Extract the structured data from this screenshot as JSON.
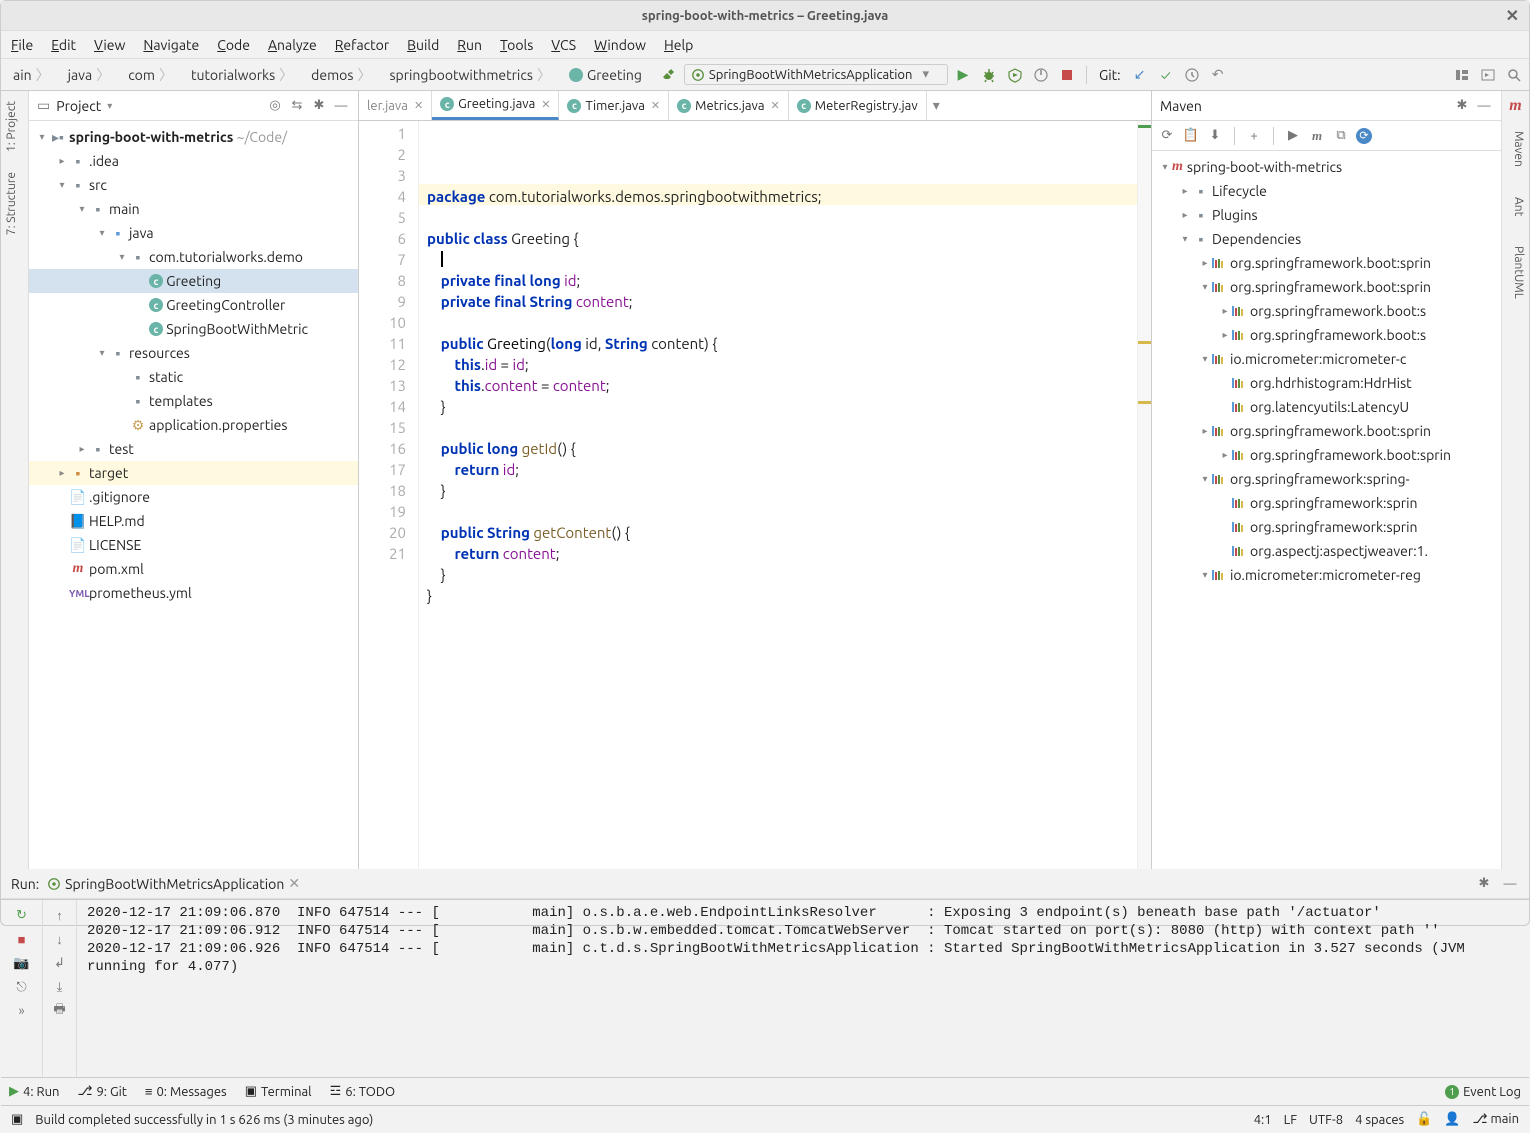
{
  "window": {
    "title": "spring-boot-with-metrics – Greeting.java"
  },
  "menu": [
    "File",
    "Edit",
    "View",
    "Navigate",
    "Code",
    "Analyze",
    "Refactor",
    "Build",
    "Run",
    "Tools",
    "VCS",
    "Window",
    "Help"
  ],
  "breadcrumbs": [
    "ain",
    "java",
    "com",
    "tutorialworks",
    "demos",
    "springbootwithmetrics",
    "Greeting"
  ],
  "runConfig": "SpringBootWithMetricsApplication",
  "git_label": "Git:",
  "leftGutter": [
    "1: Project",
    "7: Structure"
  ],
  "rightGutter": [
    "Maven",
    "Ant",
    "PlantUML"
  ],
  "projectPanel": {
    "title": "Project"
  },
  "projectTree": {
    "root": {
      "name": "spring-boot-with-metrics",
      "path": "~/Code/"
    },
    "items": [
      ".idea",
      "src",
      "main",
      "java",
      "com.tutorialworks.demo",
      "Greeting",
      "GreetingController",
      "SpringBootWithMetric",
      "resources",
      "static",
      "templates",
      "application.properties",
      "test",
      "target",
      ".gitignore",
      "HELP.md",
      "LICENSE",
      "pom.xml",
      "prometheus.yml"
    ]
  },
  "tabs": [
    {
      "label": "ler.java",
      "active": false,
      "partial": true
    },
    {
      "label": "Greeting.java",
      "active": true
    },
    {
      "label": "Timer.java",
      "active": false
    },
    {
      "label": "Metrics.java",
      "active": false
    },
    {
      "label": "MeterRegistry.jav",
      "active": false,
      "partial": true
    }
  ],
  "lineCount": 21,
  "codeLines": [
    "package com.tutorialworks.demos.springbootwithmetrics;",
    "",
    "public class Greeting {",
    "    ",
    "    private final long id;",
    "    private final String content;",
    "",
    "    public Greeting(long id, String content) {",
    "        this.id = id;",
    "        this.content = content;",
    "    }",
    "",
    "    public long getId() {",
    "        return id;",
    "    }",
    "",
    "    public String getContent() {",
    "        return content;",
    "    }",
    "}",
    ""
  ],
  "mavenPanel": {
    "title": "Maven"
  },
  "mavenTree": {
    "rootProject": "spring-boot-with-metrics",
    "folders": [
      "Lifecycle",
      "Plugins",
      "Dependencies"
    ],
    "deps": [
      "org.springframework.boot:sprin",
      "org.springframework.boot:sprin",
      "org.springframework.boot:s",
      "org.springframework.boot:s",
      "io.micrometer:micrometer-c",
      "org.hdrhistogram:HdrHist",
      "org.latencyutils:LatencyU",
      "org.springframework.boot:sprin",
      "org.springframework.boot:sprin",
      "org.springframework:spring-",
      "org.springframework:sprin",
      "org.springframework:sprin",
      "org.aspectj:aspectjweaver:1.",
      "io.micrometer:micrometer-reg"
    ]
  },
  "runPanel": {
    "label": "Run:",
    "tabName": "SpringBootWithMetricsApplication",
    "consoleText": "2020-12-17 21:09:06.870  INFO 647514 --- [           main] o.s.b.a.e.web.EndpointLinksResolver      : Exposing 3 endpoint(s) beneath base path '/actuator'\n2020-12-17 21:09:06.912  INFO 647514 --- [           main] o.s.b.w.embedded.tomcat.TomcatWebServer  : Tomcat started on port(s): 8080 (http) with context path ''\n2020-12-17 21:09:06.926  INFO 647514 --- [           main] c.t.d.s.SpringBootWithMetricsApplication : Started SpringBootWithMetricsApplication in 3.527 seconds (JVM running for 4.077)"
  },
  "bottomTabs": [
    "4: Run",
    "9: Git",
    "0: Messages",
    "Terminal",
    "6: TODO"
  ],
  "bottomRight": "Event Log",
  "status": {
    "message": "Build completed successfully in 1 s 626 ms (3 minutes ago)",
    "pos": "4:1",
    "sep": "LF",
    "enc": "UTF-8",
    "indent": "4 spaces",
    "branch": "main"
  }
}
